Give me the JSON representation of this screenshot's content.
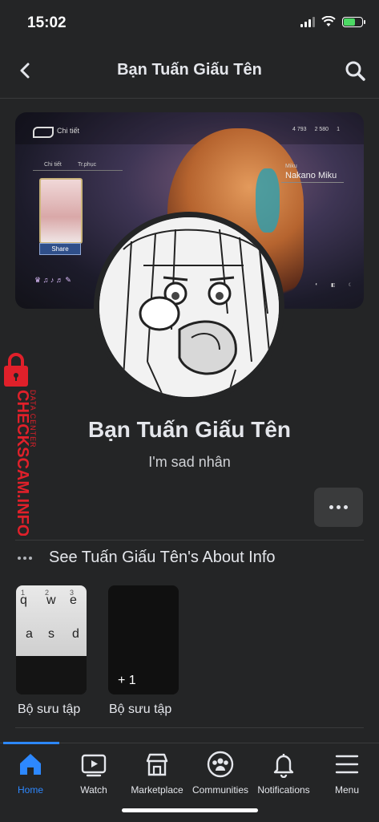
{
  "status_bar": {
    "time": "15:02"
  },
  "header": {
    "title": "Bạn Tuấn Giấu Tên"
  },
  "cover": {
    "game_tab": "Chi tiết",
    "stat_1": "4 793",
    "stat_2": "2 580",
    "stat_3": "1",
    "subtab_1": "Chi tiết",
    "subtab_2": "Tr.phục",
    "share_label": "Share",
    "char_label": "Miku",
    "char_name": "Nakano Miku"
  },
  "profile": {
    "name": "Bạn Tuấn Giấu Tên",
    "bio": "I'm sad nhân"
  },
  "about": {
    "label": "See Tuấn Giấu Tên's About Info"
  },
  "collections": [
    {
      "label": "Bộ sưu tập",
      "keys": [
        "q",
        "w",
        "e",
        "a",
        "s",
        "d"
      ]
    },
    {
      "label": "Bộ sưu tập",
      "count": "+ 1"
    }
  ],
  "watermark": {
    "brand": "CHECKSCAM.INFO",
    "sub": "DATA CENTER"
  },
  "tabs": [
    {
      "label": "Home",
      "icon": "home-icon",
      "active": true
    },
    {
      "label": "Watch",
      "icon": "watch-icon"
    },
    {
      "label": "Marketplace",
      "icon": "marketplace-icon"
    },
    {
      "label": "Communities",
      "icon": "communities-icon"
    },
    {
      "label": "Notifications",
      "icon": "bell-icon"
    },
    {
      "label": "Menu",
      "icon": "menu-icon"
    }
  ],
  "colors": {
    "accent": "#2d88ff",
    "background": "#242526",
    "watermark": "#e0202a"
  }
}
